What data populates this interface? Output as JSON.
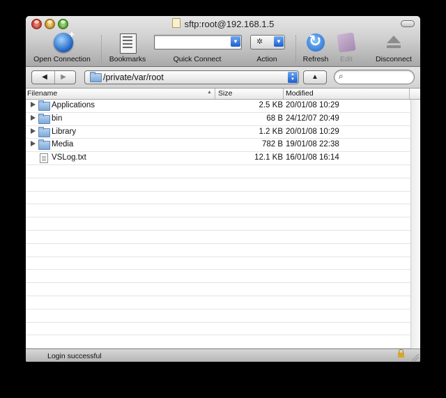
{
  "window": {
    "title": "sftp:root@192.168.1.5"
  },
  "toolbar": {
    "open_connection": "Open Connection",
    "bookmarks": "Bookmarks",
    "quick_connect": "Quick Connect",
    "quick_connect_value": "",
    "action": "Action",
    "refresh": "Refresh",
    "edit": "Edit",
    "disconnect": "Disconnect"
  },
  "navigation": {
    "back_icon": "back-arrow-icon",
    "forward_icon": "forward-arrow-icon",
    "path": "/private/var/root",
    "up_icon": "up-arrow-icon",
    "search_value": ""
  },
  "columns": {
    "filename": "Filename",
    "size": "Size",
    "modified": "Modified"
  },
  "files": [
    {
      "name": "Applications",
      "size": "2.5 KB",
      "modified": "20/01/08 10:29",
      "kind": "folder"
    },
    {
      "name": "bin",
      "size": "68 B",
      "modified": "24/12/07 20:49",
      "kind": "folder"
    },
    {
      "name": "Library",
      "size": "1.2 KB",
      "modified": "20/01/08 10:29",
      "kind": "folder"
    },
    {
      "name": "Media",
      "size": "782 B",
      "modified": "19/01/08 22:38",
      "kind": "folder"
    },
    {
      "name": "VSLog.txt",
      "size": "12.1 KB",
      "modified": "16/01/08 16:14",
      "kind": "file"
    }
  ],
  "status": {
    "message": "Login successful"
  }
}
